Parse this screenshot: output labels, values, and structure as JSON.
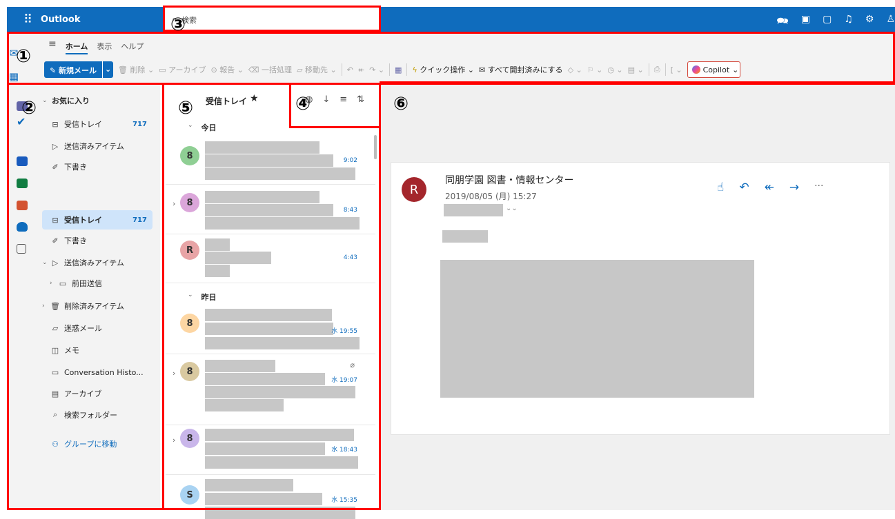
{
  "app": {
    "title": "Outlook",
    "waffle_icon": "app-launcher-icon"
  },
  "search": {
    "placeholder": "検索"
  },
  "top_icons": [
    "meet-now-icon",
    "teams-icon",
    "whats-new-icon",
    "bell-icon",
    "gear-icon",
    "account-icon"
  ],
  "ribbon": {
    "tabs": [
      "ホーム",
      "表示",
      "ヘルプ"
    ],
    "new_mail": "新規メール",
    "delete": "削除",
    "archive": "アーカイブ",
    "report": "報告",
    "sweep": "一括処理",
    "move_to": "移動先",
    "quick_steps": "クイック操作",
    "mark_all_read": "すべて開封済みにする",
    "copilot": "Copilot"
  },
  "folders": {
    "favorites_header": "お気に入り",
    "fav_inbox": "受信トレイ",
    "fav_inbox_count": "717",
    "fav_sent": "送信済みアイテム",
    "fav_drafts": "下書き",
    "inbox": "受信トレイ",
    "inbox_count": "717",
    "drafts": "下書き",
    "sent": "送信済みアイテム",
    "sent_sub": "前田送信",
    "deleted": "削除済みアイテム",
    "junk": "迷惑メール",
    "notes": "メモ",
    "conversation_history": "Conversation Histo...",
    "archive": "アーカイブ",
    "search_folders": "検索フォルダー",
    "go_to_groups": "グループに移動"
  },
  "message_list": {
    "title": "受信トレイ",
    "group_today": "今日",
    "group_yesterday": "昨日",
    "messages": [
      {
        "time": "9:02",
        "avatar": "8",
        "avatar_bg": "#8fcf94"
      },
      {
        "time": "8:43",
        "avatar": "8",
        "avatar_bg": "#dba6da"
      },
      {
        "time": "4:43",
        "avatar": "R",
        "avatar_bg": "#e8a4a6"
      },
      {
        "time": "水 19:55",
        "avatar": "8",
        "avatar_bg": "#fdd6a3"
      },
      {
        "time": "水 19:07",
        "avatar": "8",
        "avatar_bg": "#d9c9a0"
      },
      {
        "time": "水 18:43",
        "avatar": "8",
        "avatar_bg": "#c9b6ea"
      },
      {
        "time": "水 15:35",
        "avatar": "S",
        "avatar_bg": "#a9d3f2"
      }
    ]
  },
  "reading_pane": {
    "sender": "同朋学園 図書・情報センター",
    "date": "2019/08/05 (月) 15:27",
    "avatar": "R"
  },
  "annotations": [
    "①",
    "②",
    "③",
    "④",
    "⑤",
    "⑥"
  ],
  "colors": {
    "brand": "#0f6cbd",
    "annotation": "#ff0000"
  }
}
